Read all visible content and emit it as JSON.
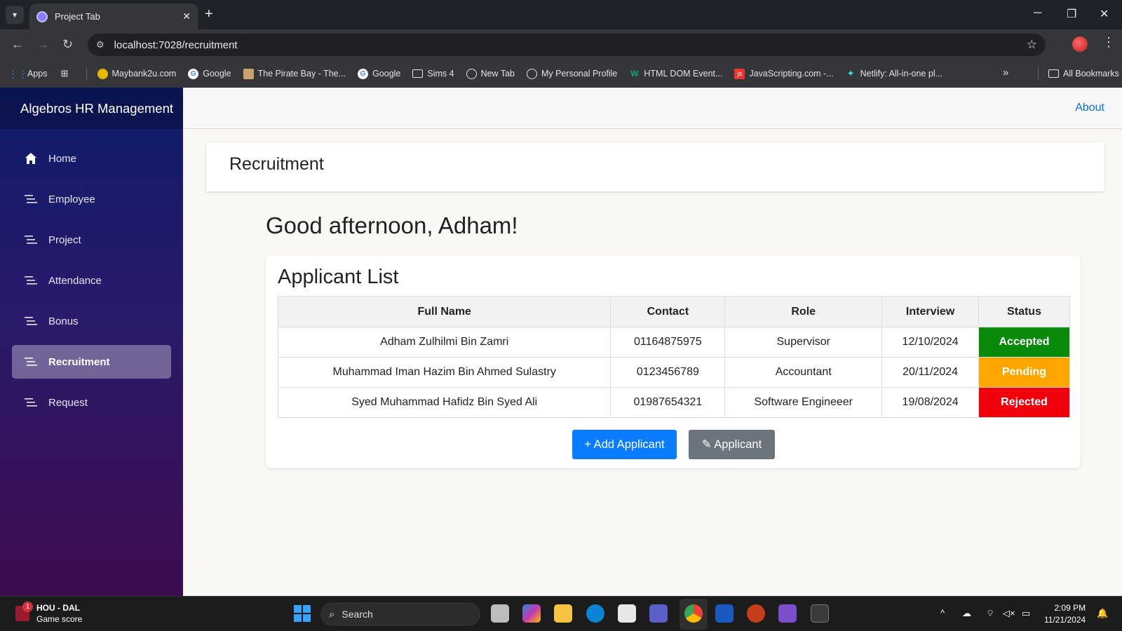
{
  "browser": {
    "tab_title": "Project Tab",
    "url": "localhost:7028/recruitment",
    "bookmarks": [
      {
        "label": "Apps",
        "icon": "apps-grid-icon",
        "color": "#4285f4"
      },
      {
        "label": "Maybank2u.com",
        "icon": "maybank-icon",
        "color": "#e6b800"
      },
      {
        "label": "Google",
        "icon": "google-icon",
        "color": "#ffffff"
      },
      {
        "label": "The Pirate Bay - The...",
        "icon": "piratebay-icon",
        "color": "#c9a36b"
      },
      {
        "label": "Google",
        "icon": "google-icon",
        "color": "#ffffff"
      },
      {
        "label": "Sims 4",
        "icon": "folder-icon",
        "color": "#e3e3e3"
      },
      {
        "label": "New Tab",
        "icon": "globe-icon",
        "color": "#e3e3e3"
      },
      {
        "label": "My Personal Profile",
        "icon": "globe-icon",
        "color": "#e3e3e3"
      },
      {
        "label": "HTML DOM Event...",
        "icon": "w3schools-icon",
        "color": "#04aa6d"
      },
      {
        "label": "JavaScripting.com -...",
        "icon": "javascripting-icon",
        "color": "#e33"
      },
      {
        "label": "Netlify: All-in-one pl...",
        "icon": "netlify-icon",
        "color": "#32e6e2"
      }
    ],
    "all_bookmarks": "All Bookmarks"
  },
  "app": {
    "brand": "Algebros HR Management",
    "about": "About",
    "nav": [
      {
        "label": "Home",
        "icon": "home-icon",
        "active": false
      },
      {
        "label": "Employee",
        "icon": "menu-lines-icon",
        "active": false
      },
      {
        "label": "Project",
        "icon": "menu-lines-icon",
        "active": false
      },
      {
        "label": "Attendance",
        "icon": "menu-lines-icon",
        "active": false
      },
      {
        "label": "Bonus",
        "icon": "menu-lines-icon",
        "active": false
      },
      {
        "label": "Recruitment",
        "icon": "menu-lines-icon",
        "active": true
      },
      {
        "label": "Request",
        "icon": "menu-lines-icon",
        "active": false
      }
    ],
    "page_title": "Recruitment",
    "greeting": "Good afternoon, Adham!",
    "list_title": "Applicant List",
    "columns": [
      "Full Name",
      "Contact",
      "Role",
      "Interview",
      "Status"
    ],
    "rows": [
      {
        "name": "Adham Zulhilmi Bin Zamri",
        "contact": "01164875975",
        "role": "Supervisor",
        "interview": "12/10/2024",
        "status": "Accepted",
        "status_color": "#0a8a0a"
      },
      {
        "name": "Muhammad Iman Hazim Bin Ahmed Sulastry",
        "contact": "0123456789",
        "role": "Accountant",
        "interview": "20/11/2024",
        "status": "Pending",
        "status_color": "#ffa500"
      },
      {
        "name": "Syed Muhammad Hafidz Bin Syed Ali",
        "contact": "01987654321",
        "role": "Software Engineeer",
        "interview": "19/08/2024",
        "status": "Rejected",
        "status_color": "#f0000b"
      }
    ],
    "add_button": "+ Add Applicant",
    "edit_button": "✎ Applicant"
  },
  "taskbar": {
    "weather_line1": "HOU - DAL",
    "weather_line2": "Game score",
    "weather_badge": "1",
    "search_placeholder": "Search",
    "time": "2:09 PM",
    "date": "11/21/2024"
  }
}
